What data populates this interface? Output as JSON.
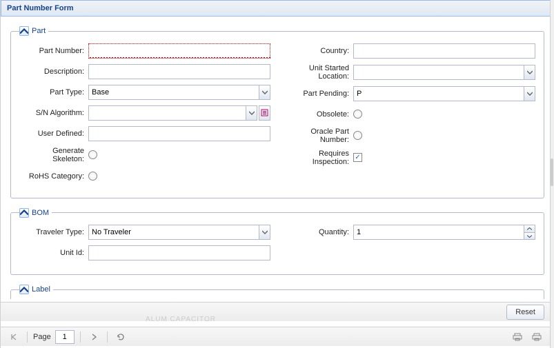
{
  "title": "Part Number Form",
  "part": {
    "legend": "Part",
    "part_number": {
      "label": "Part Number:",
      "value": ""
    },
    "description": {
      "label": "Description:",
      "value": ""
    },
    "part_type": {
      "label": "Part Type:",
      "value": "Base"
    },
    "sn_algorithm": {
      "label": "S/N Algorithm:",
      "value": ""
    },
    "user_defined": {
      "label": "User Defined:",
      "value": ""
    },
    "generate_skeleton": {
      "label": "Generate Skeleton:",
      "checked": false
    },
    "rohs_category": {
      "label": "RoHS Category:",
      "checked": false
    },
    "country": {
      "label": "Country:",
      "value": ""
    },
    "unit_started_location": {
      "label": "Unit Started Location:",
      "value": ""
    },
    "part_pending": {
      "label": "Part Pending:",
      "value": "P"
    },
    "obsolete": {
      "label": "Obsolete:",
      "checked": false
    },
    "oracle_part_number": {
      "label": "Oracle Part Number:",
      "checked": false
    },
    "requires_inspection": {
      "label": "Requires Inspection:",
      "checked": true
    }
  },
  "bom": {
    "legend": "BOM",
    "traveler_type": {
      "label": "Traveler Type:",
      "value": "No Traveler"
    },
    "unit_id": {
      "label": "Unit Id:",
      "value": ""
    },
    "quantity": {
      "label": "Quantity:",
      "value": "1"
    }
  },
  "label_section": {
    "legend": "Label"
  },
  "buttons": {
    "reset": "Reset"
  },
  "pager": {
    "page_label": "Page",
    "page": "1"
  },
  "ghost": "ALUM CAPACITOR"
}
